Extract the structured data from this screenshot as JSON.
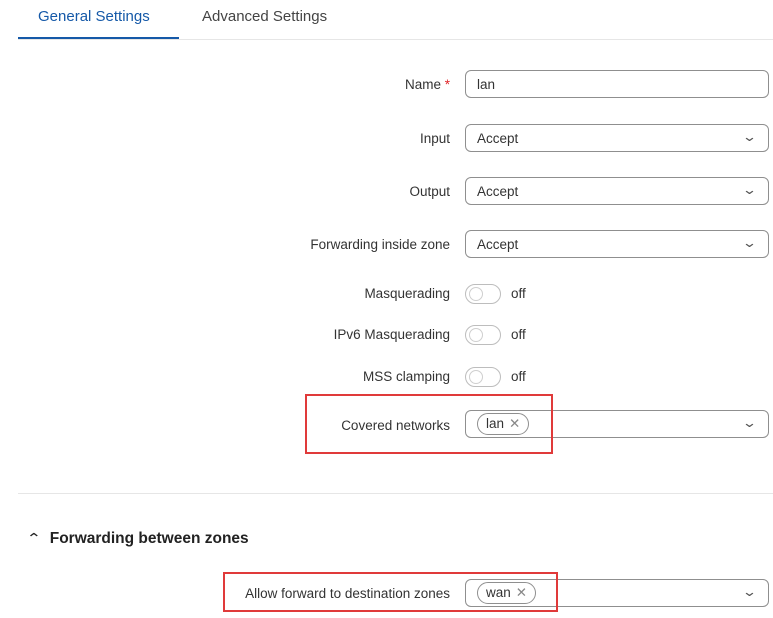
{
  "tabs": [
    {
      "label": "General Settings",
      "active": true
    },
    {
      "label": "Advanced Settings",
      "active": false
    }
  ],
  "form": {
    "name": {
      "label": "Name",
      "required_mark": "*",
      "value": "lan"
    },
    "input": {
      "label": "Input",
      "value": "Accept"
    },
    "output": {
      "label": "Output",
      "value": "Accept"
    },
    "forwarding_inside_zone": {
      "label": "Forwarding inside zone",
      "value": "Accept"
    },
    "masquerading": {
      "label": "Masquerading",
      "state": "off"
    },
    "ipv6_masquerading": {
      "label": "IPv6 Masquerading",
      "state": "off"
    },
    "mss_clamping": {
      "label": "MSS clamping",
      "state": "off"
    },
    "covered_networks": {
      "label": "Covered networks",
      "chips": [
        "lan"
      ]
    }
  },
  "forwarding_section": {
    "title": "Forwarding between zones",
    "allow_forward": {
      "label": "Allow forward to destination zones",
      "chips": [
        "wan"
      ]
    }
  },
  "icons": {
    "chevron": "chevron-down-icon",
    "remove": "close-icon",
    "collapse": "chevron-up-icon"
  },
  "colors": {
    "accent": "#1559a8",
    "required": "#e0262a",
    "highlight": "#e03a3a"
  }
}
